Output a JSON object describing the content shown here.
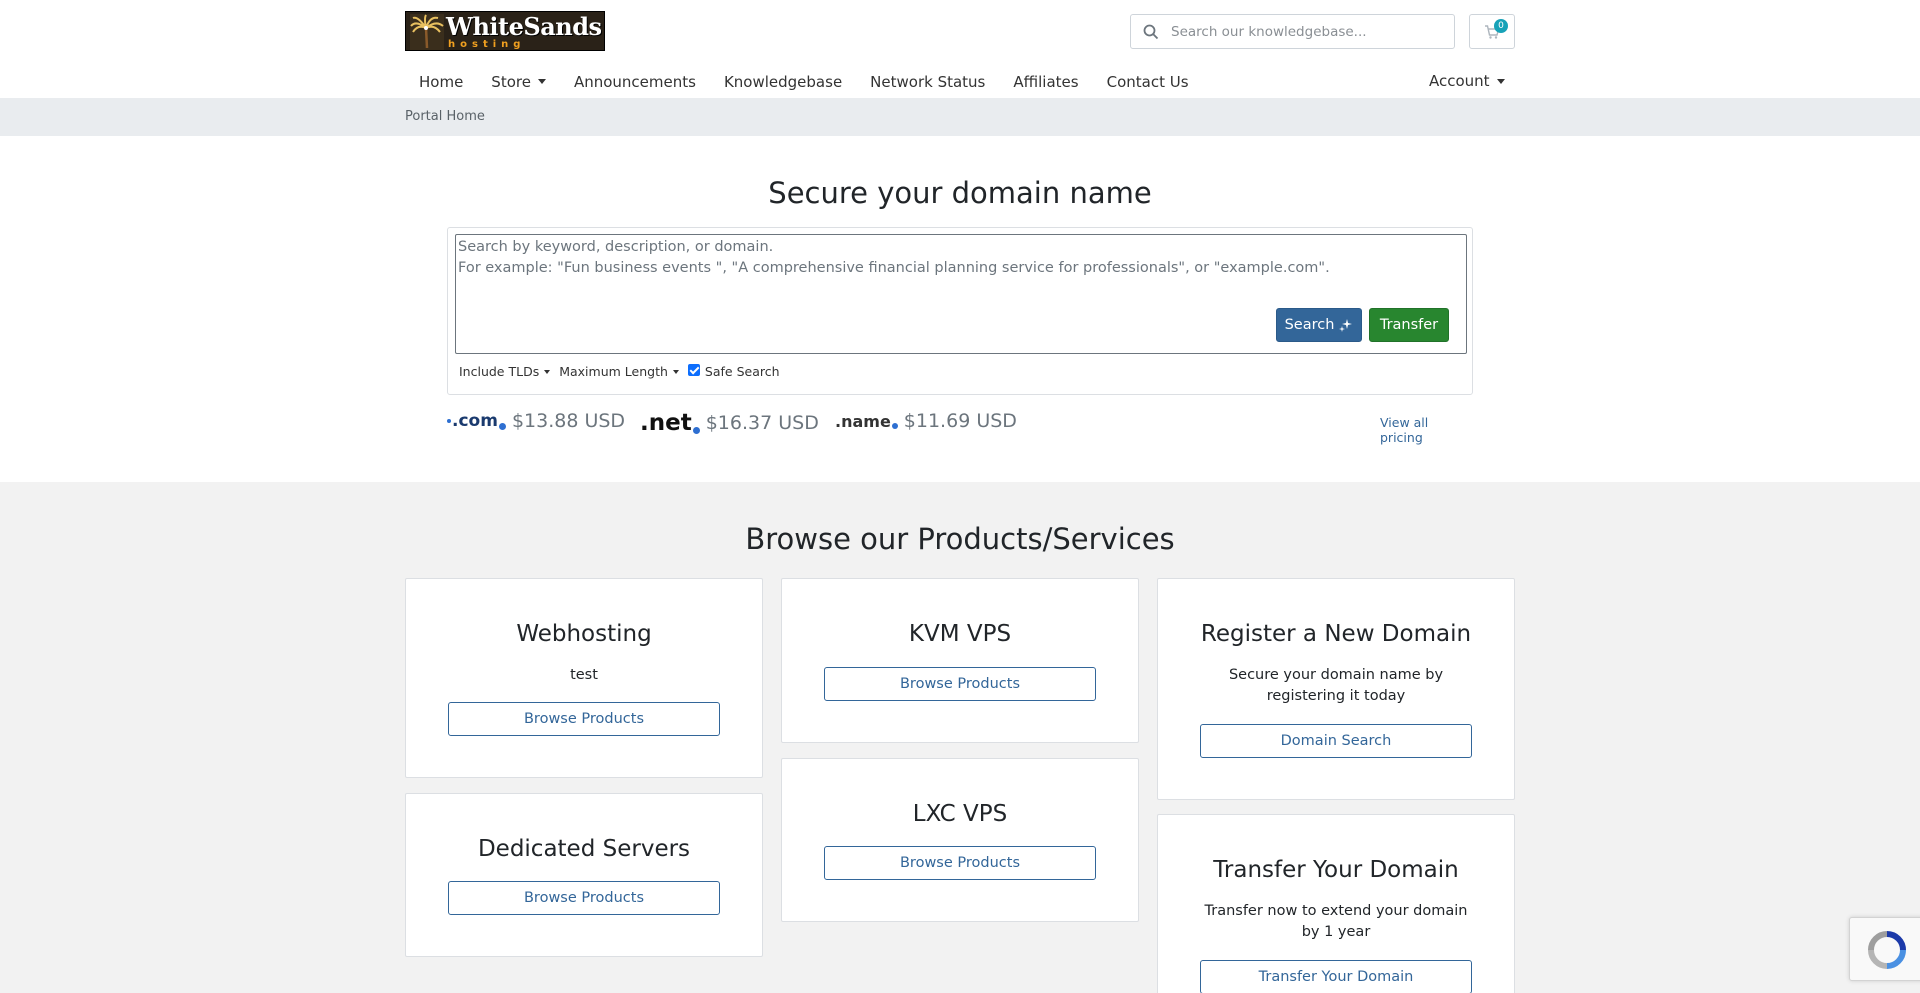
{
  "header": {
    "logo_brand": "WhiteSands",
    "logo_sub": "hosting",
    "search_placeholder": "Search our knowledgebase...",
    "cart_count": "0"
  },
  "nav": {
    "items": [
      "Home",
      "Store",
      "Announcements",
      "Knowledgebase",
      "Network Status",
      "Affiliates",
      "Contact Us"
    ],
    "account": "Account"
  },
  "breadcrumb": "Portal Home",
  "domain": {
    "title": "Secure your domain name",
    "placeholder_line1": "Search by keyword, description, or domain.",
    "placeholder_line2": "For example: \"Fun business events \", \"A comprehensive financial planning service for professionals\", or \"example.com\".",
    "search_label": "Search",
    "transfer_label": "Transfer",
    "include_tlds": "Include TLDs",
    "max_length": "Maximum Length",
    "safe_search": "Safe Search",
    "safe_search_checked": true,
    "tlds": [
      {
        "name": ".com",
        "price": "$13.88 USD"
      },
      {
        "name": ".net",
        "price": "$16.37 USD"
      },
      {
        "name": ".name",
        "price": "$11.69 USD"
      }
    ],
    "view_all": "View all pricing"
  },
  "products": {
    "title": "Browse our Products/Services",
    "cards": [
      {
        "title": "Webhosting",
        "desc": "test",
        "button": "Browse Products"
      },
      {
        "title": "KVM VPS",
        "desc": "",
        "button": "Browse Products"
      },
      {
        "title": "Register a New Domain",
        "desc": "Secure your domain name by registering it today",
        "button": "Domain Search"
      },
      {
        "title": "Dedicated Servers",
        "desc": "",
        "button": "Browse Products"
      },
      {
        "title": "LXC VPS",
        "desc": "",
        "button": "Browse Products"
      },
      {
        "title": "Transfer Your Domain",
        "desc": "Transfer now to extend your domain by 1 year",
        "button": "Transfer Your Domain"
      }
    ]
  },
  "colors": {
    "primary": "#336699",
    "success": "#28862f",
    "badge": "#17a2b8",
    "section_bg": "#f2f2f2"
  }
}
